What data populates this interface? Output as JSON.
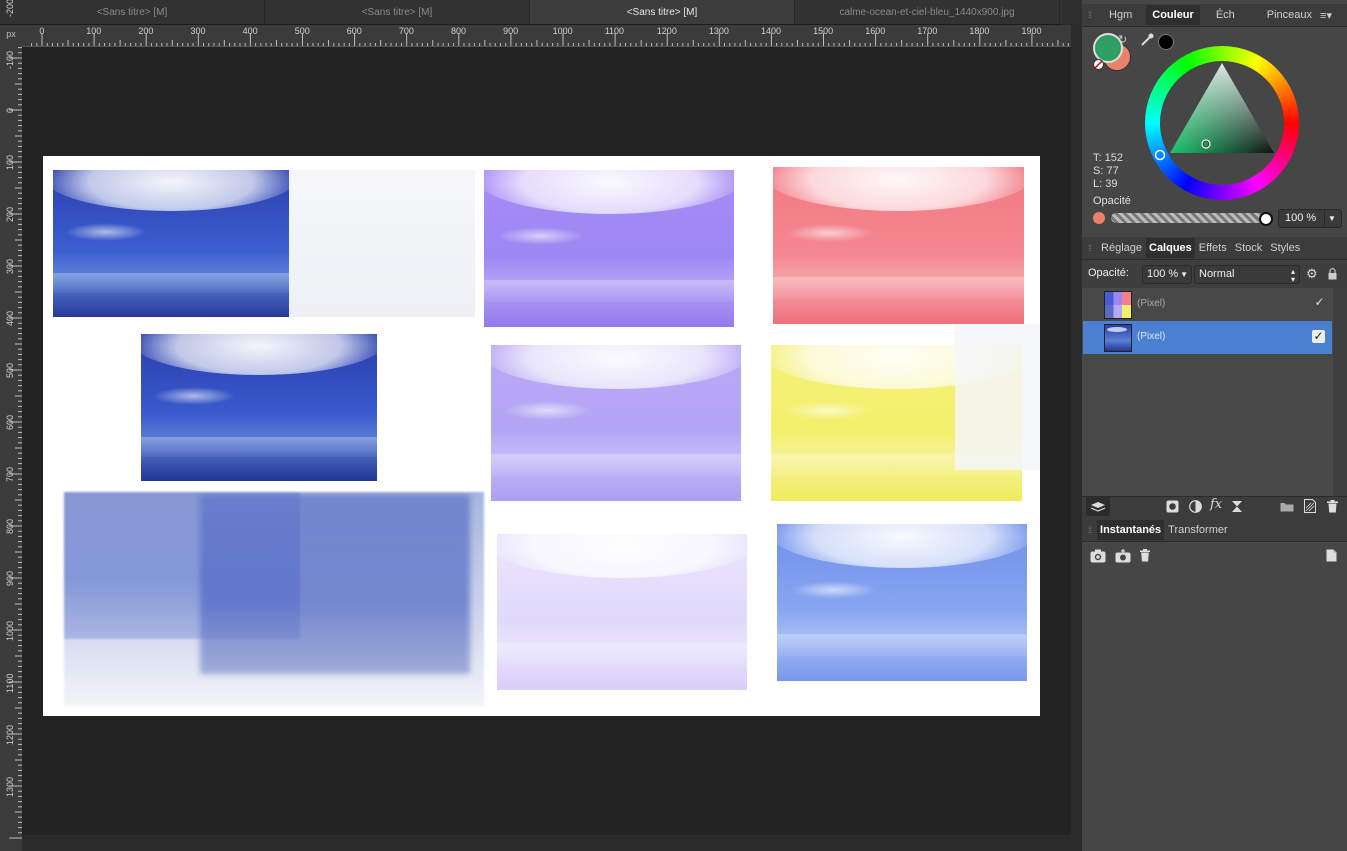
{
  "tabs": [
    {
      "label": "<Sans titre> [M]",
      "active": false
    },
    {
      "label": "<Sans titre> [M]",
      "active": false
    },
    {
      "label": "<Sans titre> [M]",
      "active": true
    },
    {
      "label": "calme-ocean-et-ciel-bleu_1440x900.jpg",
      "active": false
    }
  ],
  "ruler": {
    "unit": "px",
    "h_ticks": [
      "0",
      "100",
      "200",
      "300",
      "400",
      "500",
      "600",
      "700",
      "800",
      "900",
      "1000",
      "1100",
      "1200",
      "1300",
      "1400",
      "1500",
      "1600",
      "1700",
      "1800",
      "1900"
    ],
    "v_ticks": [
      "-200",
      "-100",
      "0",
      "100",
      "200",
      "300",
      "400",
      "500",
      "600",
      "700",
      "800",
      "900",
      "1000",
      "1100",
      "1200",
      "1300"
    ]
  },
  "color_panel": {
    "tabs": [
      "Hgm",
      "Couleur",
      "Éch",
      "Pinceaux"
    ],
    "active_tab": "Couleur",
    "primary_color": "#2f9e62",
    "secondary_color": "#e8826a",
    "black_swatch": "#000000",
    "hue_label": "T: 152",
    "sat_label": "S: 77",
    "lum_label": "L: 39",
    "opacity_label": "Opacité",
    "opacity_value": "100 %",
    "icons": [
      "swap-icon",
      "eyedropper-icon",
      "no-fill-icon",
      "menu-icon"
    ]
  },
  "layers_panel": {
    "tabs": [
      "Réglage",
      "Calques",
      "Effets",
      "Stock",
      "Styles"
    ],
    "active_tab": "Calques",
    "opacity_label": "Opacité:",
    "opacity_value": "100 %",
    "blend_mode": "Normal",
    "layers": [
      {
        "name": "(Pixel)",
        "selected": false,
        "visible": true
      },
      {
        "name": "(Pixel)",
        "selected": true,
        "visible": true
      }
    ],
    "toolbar_icons": [
      "layers-stack-icon",
      "mask-icon",
      "adjustment-icon",
      "fx-icon",
      "hourglass-icon",
      "folder-icon",
      "new-layer-icon",
      "trash-icon"
    ],
    "fx_label": "fx"
  },
  "snapshots_panel": {
    "tabs": [
      "Instantanés",
      "Transformer"
    ],
    "active_tab": "Instantanés",
    "icons": [
      "restore-snapshot-icon",
      "add-snapshot-icon",
      "delete-snapshot-icon",
      "document-icon"
    ]
  },
  "canvas": {
    "images": [
      {
        "name": "ocean-blue-1",
        "tint": "#3a52c8"
      },
      {
        "name": "ocean-faded-white",
        "tint": "#f3f4f8"
      },
      {
        "name": "ocean-purple-1",
        "tint": "#9b86f3"
      },
      {
        "name": "ocean-pink",
        "tint": "#f2808a"
      },
      {
        "name": "ocean-blue-2",
        "tint": "#3650c6"
      },
      {
        "name": "ocean-lavender",
        "tint": "#b6a8f5"
      },
      {
        "name": "ocean-yellow",
        "tint": "#f2f06a"
      },
      {
        "name": "ocean-blurred",
        "tint": "#5a6cc0"
      },
      {
        "name": "ocean-pale-lavender",
        "tint": "#ddd6fb"
      },
      {
        "name": "ocean-light-blue",
        "tint": "#7c9ef0"
      }
    ]
  }
}
